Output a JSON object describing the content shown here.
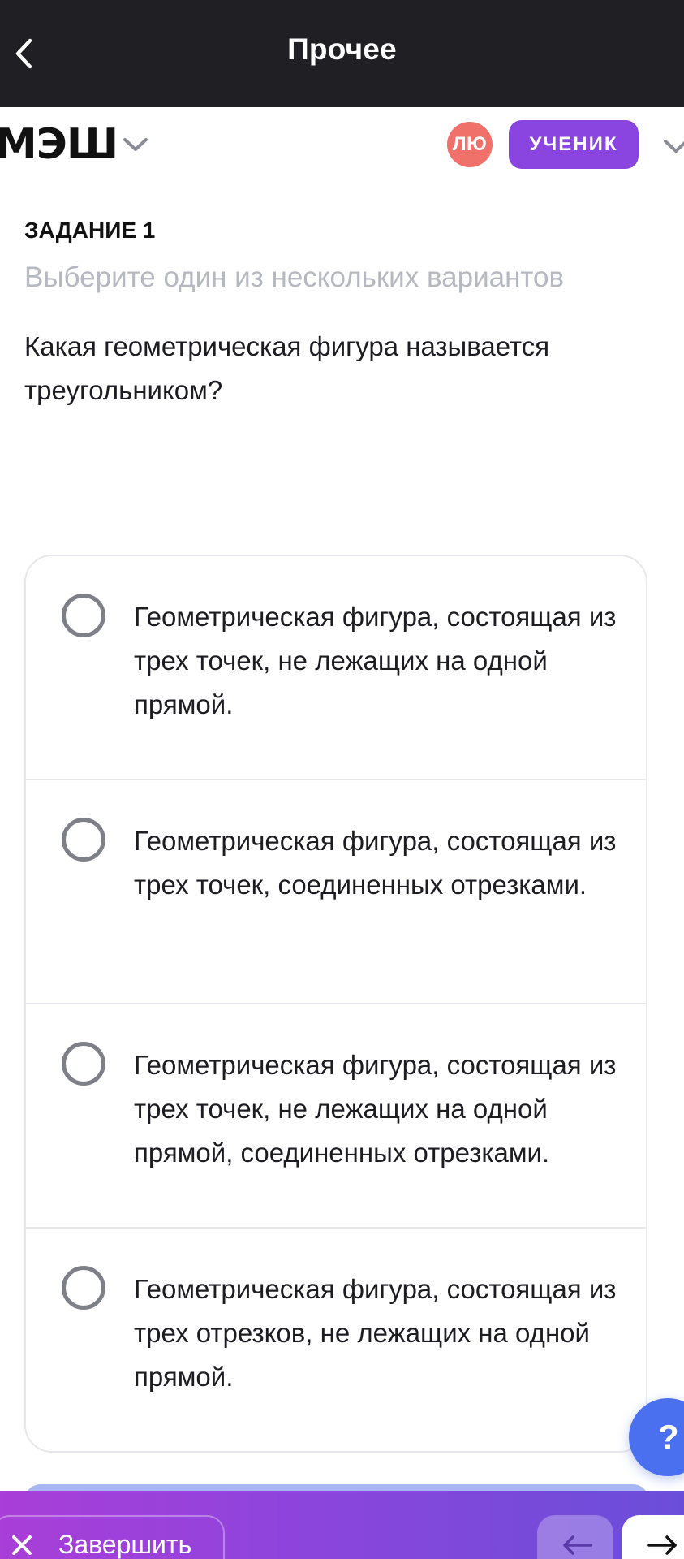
{
  "topbar": {
    "title": "Прочее"
  },
  "header": {
    "logo": "МЭШ",
    "avatar_initials": "ЛЮ",
    "role_label": "УЧЕНИК"
  },
  "task": {
    "label": "ЗАДАНИЕ 1",
    "hint": "Выберите один из нескольких вариантов",
    "question": "Какая геометрическая фигура называется треугольником?"
  },
  "options": [
    {
      "text": "Геометрическая фигура, состоящая из трех точек, не лежащих на одной прямой."
    },
    {
      "text": "Геометрическая фигура, состоящая из трех точек, соединенных отрезками."
    },
    {
      "text": "Геометрическая фигура, состоящая из трех точек, не лежащих на одной прямой, соединенных отрезками."
    },
    {
      "text": "Геометрическая фигура, состоящая из трех отрезков, не лежащих на одной прямой."
    }
  ],
  "help": {
    "label": "?"
  },
  "bottombar": {
    "finish_label": "Завершить"
  },
  "colors": {
    "accent": "#8a44e0",
    "avatar": "#f0706a",
    "help": "#4a70f0",
    "topbar": "#1f1f24"
  }
}
